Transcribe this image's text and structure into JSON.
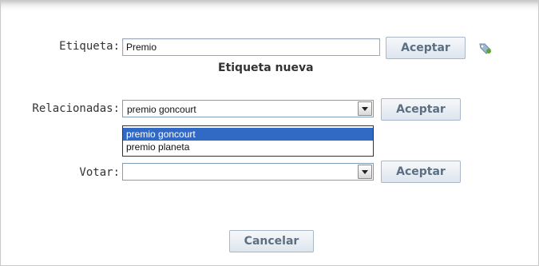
{
  "etiqueta": {
    "label": "Etiqueta:",
    "value": "Premio",
    "accept_label": "Aceptar",
    "status": "Etiqueta nueva"
  },
  "relacionadas": {
    "label": "Relacionadas:",
    "selected": "premio goncourt",
    "accept_label": "Aceptar",
    "options": [
      "premio goncourt",
      "premio planeta"
    ]
  },
  "votar": {
    "label": "Votar:",
    "selected": "",
    "accept_label": "Aceptar"
  },
  "cancel_label": "Cancelar",
  "icons": {
    "tag": "tag-icon"
  }
}
